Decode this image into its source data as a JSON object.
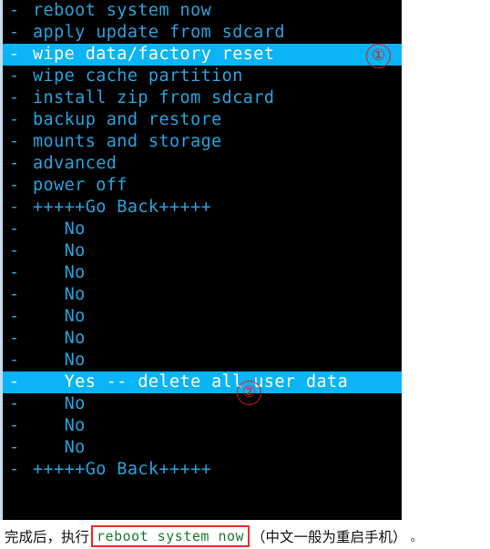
{
  "terminal": {
    "bullet": "-",
    "rows": [
      {
        "label": "reboot system now",
        "indent": 0,
        "selected": false
      },
      {
        "label": "apply update from sdcard",
        "indent": 0,
        "selected": false
      },
      {
        "label": "wipe data/factory reset",
        "indent": 0,
        "selected": true
      },
      {
        "label": "wipe cache partition",
        "indent": 0,
        "selected": false
      },
      {
        "label": "install zip from sdcard",
        "indent": 0,
        "selected": false
      },
      {
        "label": "backup and restore",
        "indent": 0,
        "selected": false
      },
      {
        "label": "mounts and storage",
        "indent": 0,
        "selected": false
      },
      {
        "label": "advanced",
        "indent": 0,
        "selected": false
      },
      {
        "label": "power off",
        "indent": 0,
        "selected": false
      },
      {
        "label": "+++++Go Back+++++",
        "indent": 0,
        "selected": false
      },
      {
        "label": "No",
        "indent": 1,
        "selected": false
      },
      {
        "label": "No",
        "indent": 1,
        "selected": false
      },
      {
        "label": "No",
        "indent": 1,
        "selected": false
      },
      {
        "label": "No",
        "indent": 1,
        "selected": false
      },
      {
        "label": "No",
        "indent": 1,
        "selected": false
      },
      {
        "label": "No",
        "indent": 1,
        "selected": false
      },
      {
        "label": "No",
        "indent": 1,
        "selected": false
      },
      {
        "label": "Yes -- delete all user data",
        "indent": 1,
        "selected": true
      },
      {
        "label": "No",
        "indent": 1,
        "selected": false
      },
      {
        "label": "No",
        "indent": 1,
        "selected": false
      },
      {
        "label": "No",
        "indent": 1,
        "selected": false
      },
      {
        "label": "+++++Go Back+++++",
        "indent": 0,
        "selected": false
      }
    ]
  },
  "markers": {
    "one": "①",
    "two": "②"
  },
  "caption": {
    "lead": "完成后，执行",
    "code": "reboot system now",
    "trail": "（中文一般为重启手机）",
    "tail": "。"
  },
  "colors": {
    "terminal_bg": "#000000",
    "menu_text": "#27a3dd",
    "highlight_bg": "#0bb4f5",
    "highlight_text": "#ffffff",
    "annotation_red": "#e01b1b",
    "code_green": "#1d7a2e",
    "code_border_red": "#ef2c2c"
  }
}
